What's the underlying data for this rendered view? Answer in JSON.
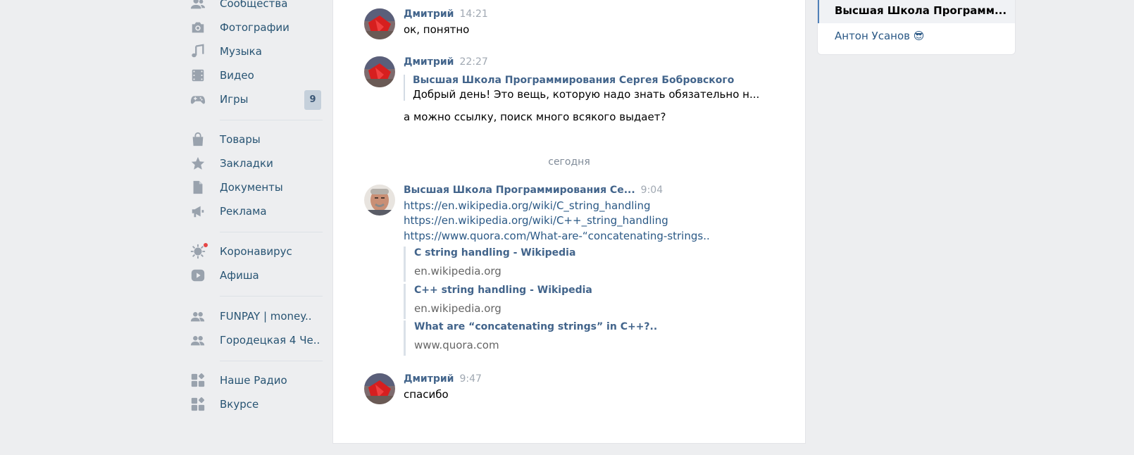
{
  "sidebar": {
    "items": [
      {
        "label": "Сообщества",
        "icon": "people-icon"
      },
      {
        "label": "Фотографии",
        "icon": "camera-icon"
      },
      {
        "label": "Музыка",
        "icon": "music-icon"
      },
      {
        "label": "Видео",
        "icon": "film-icon"
      },
      {
        "label": "Игры",
        "icon": "gamepad-icon",
        "badge": "9"
      },
      {
        "label": "Товары",
        "icon": "shopping-bag-icon"
      },
      {
        "label": "Закладки",
        "icon": "star-icon"
      },
      {
        "label": "Документы",
        "icon": "document-icon"
      },
      {
        "label": "Реклама",
        "icon": "megaphone-icon"
      },
      {
        "label": "Коронавирус",
        "icon": "virus-icon"
      },
      {
        "label": "Афиша",
        "icon": "play-icon"
      },
      {
        "label": "FUNPAY | money..",
        "icon": "group-icon"
      },
      {
        "label": "Городецкая 4 Че..",
        "icon": "group-icon"
      },
      {
        "label": "Наше Радио",
        "icon": "app-icon"
      },
      {
        "label": "Вкурсе",
        "icon": "app-icon"
      }
    ]
  },
  "chat": {
    "messages": [
      {
        "author": "Дмитрий",
        "time": "14:21",
        "text": "ок, понятно"
      },
      {
        "author": "Дмитрий",
        "time": "22:27",
        "forward_author": "Высшая Школа Программирования Сергея Бобровского",
        "forward_text": "Добрый день! Это вещь, которую надо знать обязательно н...",
        "text": "а можно ссылку, поиск много всякого выдает?"
      },
      {
        "author": "Высшая Школа Программирования Се...",
        "time": "9:04",
        "links": [
          "https://en.wikipedia.org/wiki/C_string_handling",
          "https://en.wikipedia.org/wiki/C++_string_handling",
          "https://www.quora.com/What-are-“concatenating-strings.."
        ],
        "snippets": [
          {
            "title": "C string handling - Wikipedia",
            "domain": "en.wikipedia.org"
          },
          {
            "title": "C++ string handling - Wikipedia",
            "domain": "en.wikipedia.org"
          },
          {
            "title": "What are “concatenating strings” in C++?..",
            "domain": "www.quora.com"
          }
        ]
      },
      {
        "author": "Дмитрий",
        "time": "9:47",
        "text": "спасибо"
      }
    ],
    "date_separator": "сегодня"
  },
  "right_panel": {
    "items": [
      {
        "label": "Высшая Школа Программ...",
        "active": true
      },
      {
        "label": "Антон Усанов 😎",
        "active": false
      }
    ]
  },
  "colors": {
    "background": "#edeef0",
    "link": "#2a5885",
    "author": "#42648b",
    "sidebar_text": "#285473",
    "badge": "#c5d0db"
  }
}
